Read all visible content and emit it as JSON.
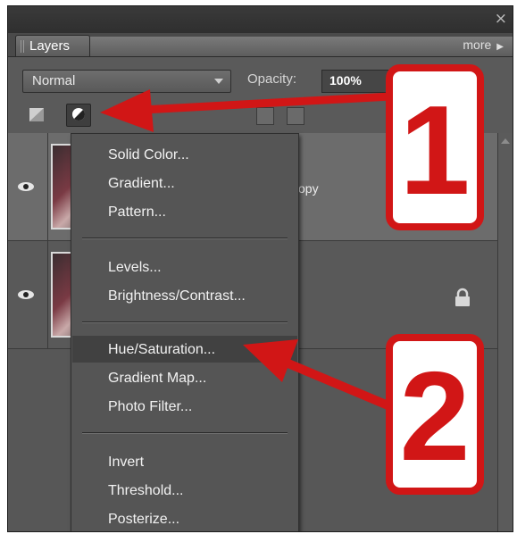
{
  "panel": {
    "tab_label": "Layers",
    "more_label": "more",
    "close_glyph": "×"
  },
  "controls": {
    "blend_mode": "Normal",
    "opacity_label": "Opacity:",
    "opacity_value": "100%"
  },
  "layers": [
    {
      "name_fragment": "copy",
      "visible": true,
      "locked": false
    },
    {
      "name_fragment": "",
      "visible": true,
      "locked": true
    }
  ],
  "adjustment_menu": {
    "groups": [
      [
        "Solid Color...",
        "Gradient...",
        "Pattern..."
      ],
      [
        "Levels...",
        "Brightness/Contrast..."
      ],
      [
        "Hue/Saturation...",
        "Gradient Map...",
        "Photo Filter..."
      ],
      [
        "Invert",
        "Threshold...",
        "Posterize..."
      ]
    ],
    "highlighted": "Hue/Saturation..."
  },
  "callouts": [
    {
      "label": "1",
      "color": "#d11616"
    },
    {
      "label": "2",
      "color": "#d11616"
    }
  ],
  "colors": {
    "panel_bg": "#4a4a4a",
    "menu_bg": "#555555",
    "highlight": "#414141",
    "annotation_red": "#d11616"
  },
  "icons": [
    "close-icon",
    "new-fill-layer-icon",
    "adjustment-layer-icon",
    "eye-icon",
    "lock-icon",
    "chevron-right-icon",
    "dropdown-arrow-icon"
  ]
}
